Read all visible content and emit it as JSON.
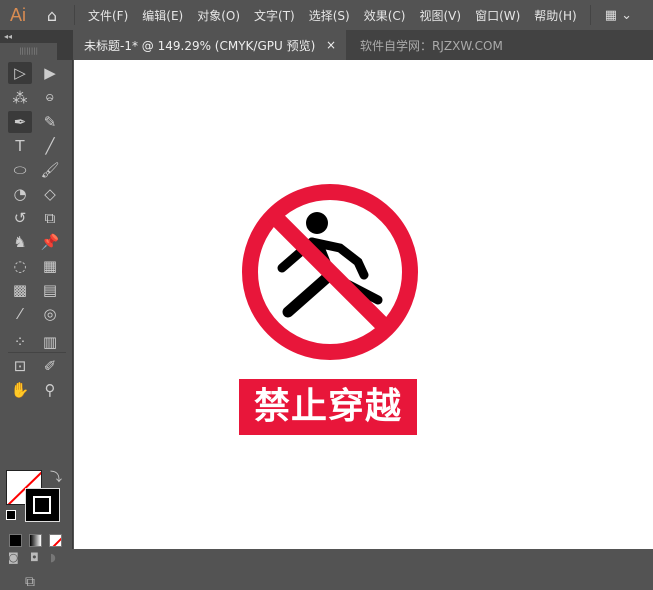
{
  "app": {
    "logo": "Ai",
    "menus": [
      "文件(F)",
      "编辑(E)",
      "对象(O)",
      "文字(T)",
      "选择(S)",
      "效果(C)",
      "视图(V)",
      "窗口(W)",
      "帮助(H)"
    ]
  },
  "tabs": {
    "active": "未标题-1* @ 149.29% (CMYK/GPU 预览)",
    "close": "×",
    "watermark": "软件自学网：RJZXW.COM"
  },
  "tools": [
    {
      "name": "selection-tool",
      "glyph": "▷"
    },
    {
      "name": "direct-selection-tool",
      "glyph": "▶"
    },
    {
      "name": "magic-wand-tool",
      "glyph": "⁂"
    },
    {
      "name": "lasso-tool",
      "glyph": "ဓ"
    },
    {
      "name": "pen-tool",
      "glyph": "✒"
    },
    {
      "name": "curvature-tool",
      "glyph": "✎"
    },
    {
      "name": "type-tool",
      "glyph": "T"
    },
    {
      "name": "line-tool",
      "glyph": "╱"
    },
    {
      "name": "ellipse-tool",
      "glyph": "⬭"
    },
    {
      "name": "paintbrush-tool",
      "glyph": "🖌"
    },
    {
      "name": "shaper-tool",
      "glyph": "◔"
    },
    {
      "name": "eraser-tool",
      "glyph": "◇"
    },
    {
      "name": "rotate-tool",
      "glyph": "↺"
    },
    {
      "name": "scale-tool",
      "glyph": "⧉"
    },
    {
      "name": "warp-tool",
      "glyph": "♞"
    },
    {
      "name": "puppet-warp-tool",
      "glyph": "📌"
    },
    {
      "name": "shape-builder-tool",
      "glyph": "◌"
    },
    {
      "name": "perspective-grid-tool",
      "glyph": "▦"
    },
    {
      "name": "mesh-tool",
      "glyph": "▩"
    },
    {
      "name": "gradient-tool",
      "glyph": "▤"
    },
    {
      "name": "eyedropper-tool",
      "glyph": "⁄"
    },
    {
      "name": "blend-tool",
      "glyph": "◎"
    },
    {
      "name": "symbol-sprayer-tool",
      "glyph": "⁘"
    },
    {
      "name": "column-graph-tool",
      "glyph": "▥"
    },
    {
      "name": "artboard-tool",
      "glyph": "⊡"
    },
    {
      "name": "slice-tool",
      "glyph": "✐"
    },
    {
      "name": "hand-tool",
      "glyph": "✋"
    },
    {
      "name": "zoom-tool",
      "glyph": "⚲"
    }
  ],
  "sign": {
    "label": "禁止穿越",
    "color": "#e8163a"
  }
}
